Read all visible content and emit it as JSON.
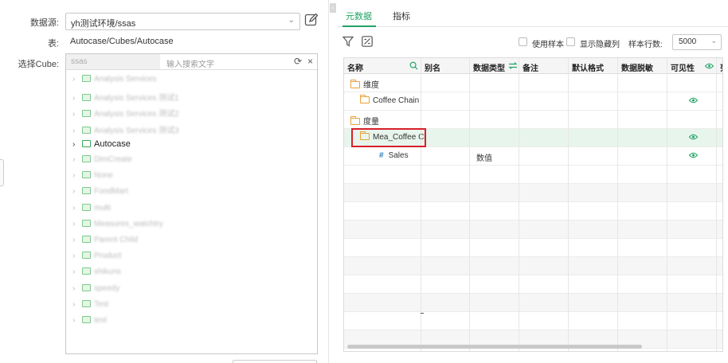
{
  "left": {
    "datasource_label": "数据源:",
    "datasource_value": "yh测试环境/ssas",
    "table_label": "表:",
    "table_value": "Autocase/Cubes/Autocase",
    "cube_label": "选择Cube:",
    "cube_search_prefix": "ssas",
    "cube_search_placeholder": "输入搜索文字",
    "tree": [
      {
        "label": "Analysis Services",
        "blurred": true
      },
      {
        "label": "Analysis Services 测试1",
        "blurred": true
      },
      {
        "label": "Analysis Services 测试2",
        "blurred": true
      },
      {
        "label": "Analysis Services 测试3",
        "blurred": true
      },
      {
        "label": "Autocase",
        "blurred": false
      },
      {
        "label": "DimCreate",
        "blurred": true
      },
      {
        "label": "None",
        "blurred": true
      },
      {
        "label": "FoodMart",
        "blurred": true
      },
      {
        "label": "multi",
        "blurred": true
      },
      {
        "label": "Measures_watchtry",
        "blurred": true
      },
      {
        "label": "Parent Child",
        "blurred": true
      },
      {
        "label": "Product",
        "blurred": true
      },
      {
        "label": "shikuns",
        "blurred": true
      },
      {
        "label": "speedy",
        "blurred": true
      },
      {
        "label": "Test",
        "blurred": true
      },
      {
        "label": "test",
        "blurred": true
      }
    ]
  },
  "right": {
    "tabs": [
      {
        "label": "元数据",
        "active": true
      },
      {
        "label": "指标",
        "active": false
      }
    ],
    "toolbar": {
      "use_sample_label": "使用样本",
      "show_hidden_label": "显示隐藏列",
      "sample_rows_label": "样本行数:",
      "sample_rows_value": "5000"
    },
    "columns": [
      "名称",
      "别名",
      "数据类型",
      "备注",
      "默认格式",
      "数据脱敏",
      "可见性",
      "列"
    ],
    "rows": [
      {
        "name": "维度",
        "type": "",
        "kind": "folder",
        "indent": 0,
        "visible": false
      },
      {
        "name": "Coffee Chain",
        "type": "",
        "kind": "folder",
        "indent": 1,
        "visible": true
      },
      {
        "name": "度量",
        "type": "",
        "kind": "folder",
        "indent": 0,
        "visible": false
      },
      {
        "name": "Mea_Coffee Cl",
        "type": "",
        "kind": "folder",
        "indent": 1,
        "visible": true,
        "selected": true
      },
      {
        "name": "Sales",
        "type": "数值",
        "kind": "measure",
        "indent": 2,
        "visible": true
      }
    ],
    "accent_color": "#21a366",
    "highlight_color": "#d8202a"
  }
}
